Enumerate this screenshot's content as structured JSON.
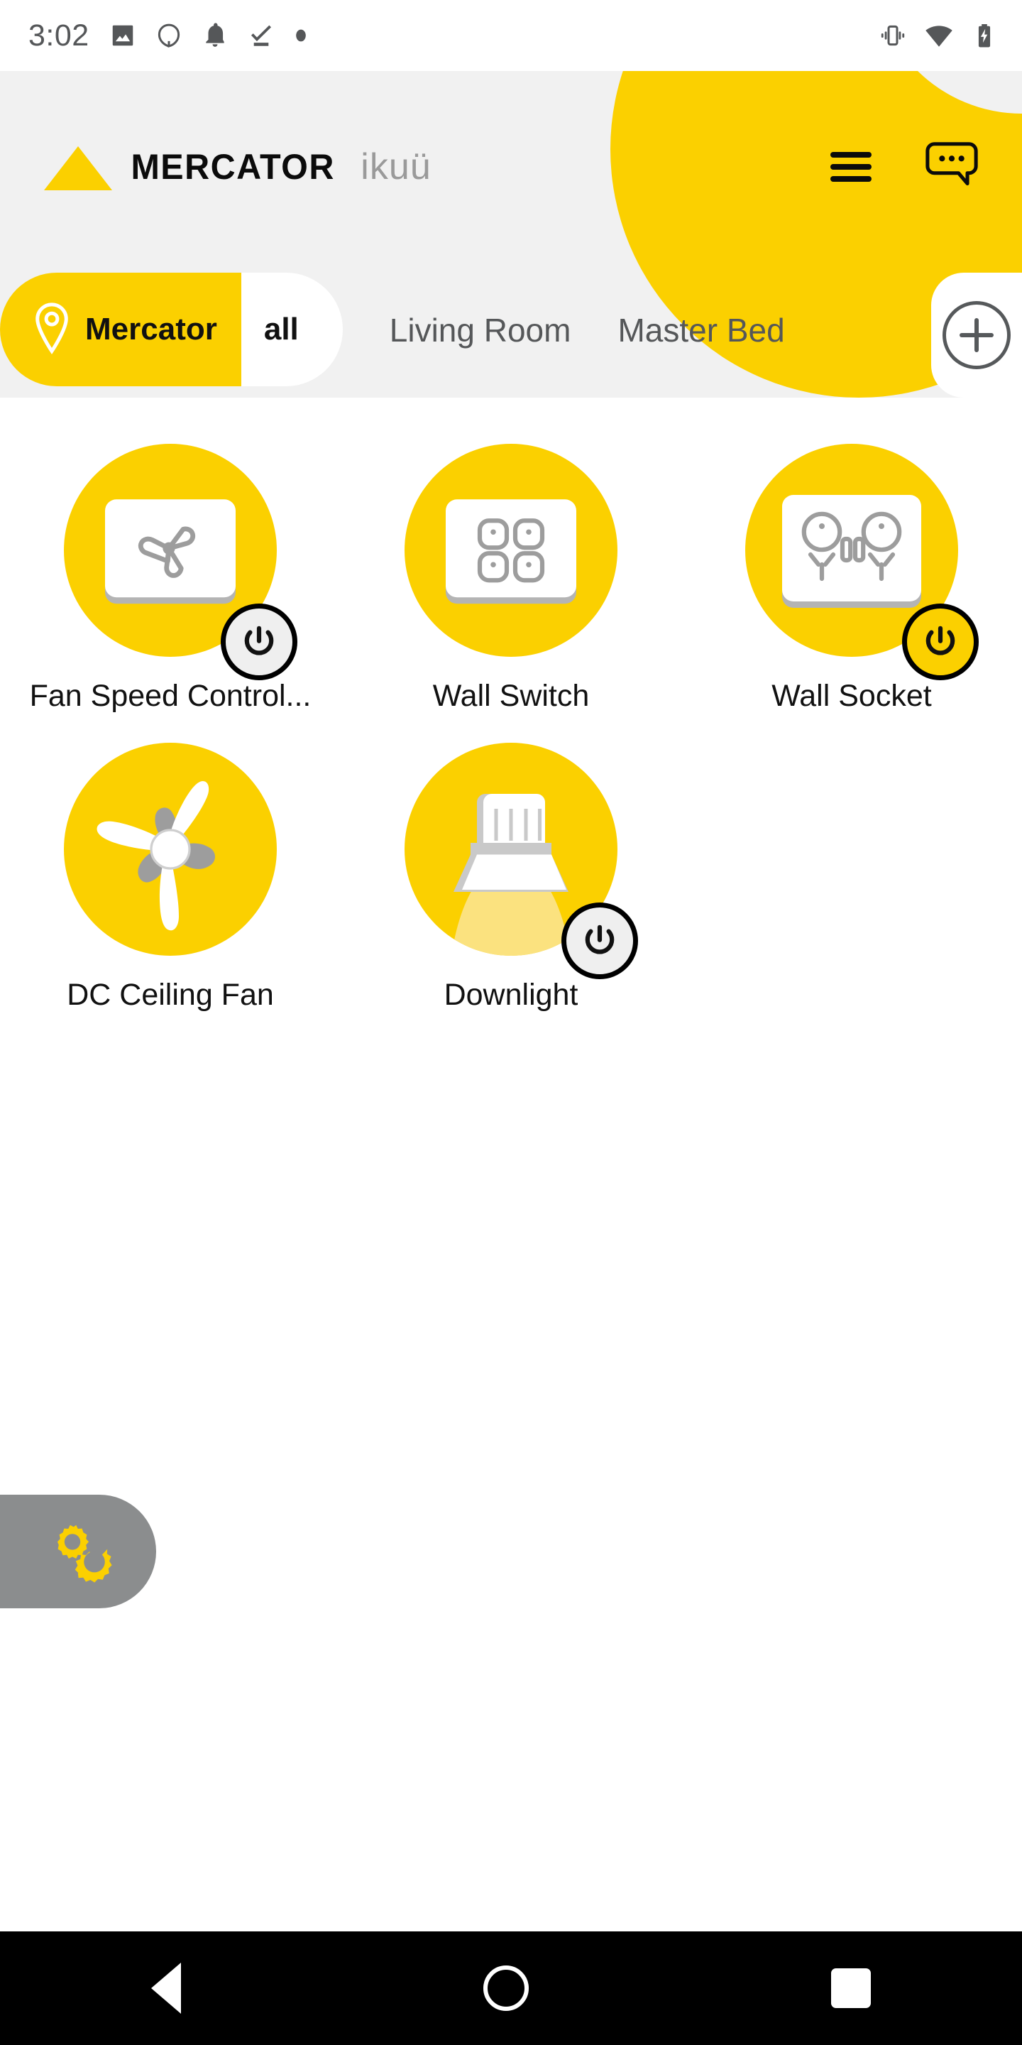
{
  "status_bar": {
    "time": "3:02",
    "left_icons": [
      "image-icon",
      "messenger-icon",
      "notification-bell-icon",
      "tasks-check-icon",
      "dot-icon"
    ],
    "right_icons": [
      "vibrate-icon",
      "wifi-icon",
      "battery-charging-icon"
    ]
  },
  "header": {
    "brand_primary": "MERCATOR",
    "brand_secondary": "ikuü",
    "menu_icon": "hamburger-menu-icon",
    "chat_icon": "chat-bubble-icon",
    "accent_color": "#fbd000",
    "background_color": "#f1f1f1"
  },
  "tabs": {
    "home_label": "Mercator",
    "home_icon": "location-pin-icon",
    "add_icon": "plus-circle-icon",
    "selected": "all",
    "items": [
      {
        "label": "all",
        "selected": true
      },
      {
        "label": "Living Room",
        "selected": false
      },
      {
        "label": "Master Bed",
        "selected": false
      }
    ]
  },
  "devices": [
    {
      "label": "Fan Speed Control...",
      "icon": "fan-speed-controller-icon",
      "power": "off",
      "has_power_button": true
    },
    {
      "label": "Wall Switch",
      "icon": "wall-switch-icon",
      "power": "none",
      "has_power_button": false
    },
    {
      "label": "Wall Socket",
      "icon": "wall-socket-icon",
      "power": "on",
      "has_power_button": true
    },
    {
      "label": "DC Ceiling Fan",
      "icon": "ceiling-fan-icon",
      "power": "none",
      "has_power_button": false
    },
    {
      "label": "Downlight",
      "icon": "downlight-icon",
      "power": "off",
      "has_power_button": true
    }
  ],
  "settings_tab": {
    "icon": "gears-settings-icon",
    "color": "#8b8d8e",
    "icon_color": "#fbd000"
  },
  "nav_bar": {
    "back": "back-triangle-icon",
    "home": "home-circle-icon",
    "recents": "recents-square-icon"
  }
}
